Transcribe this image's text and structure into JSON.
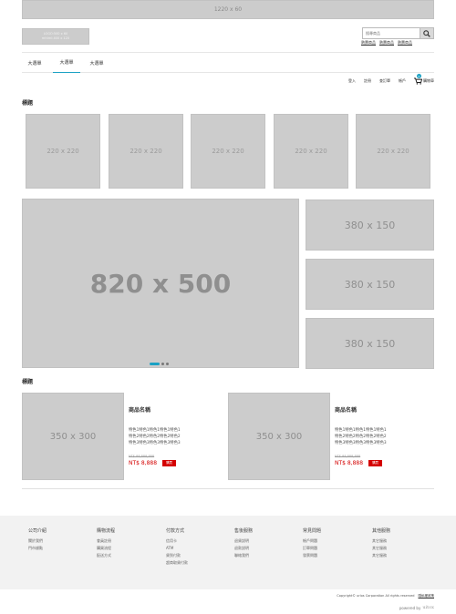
{
  "top_banner": {
    "label": "1220 x 60"
  },
  "header": {
    "logo": {
      "line1": "LOGO:500 x 60",
      "line2": "mhtml:400 x 120"
    },
    "search": {
      "placeholder": "搜尋商品"
    },
    "hot_links": [
      "熱賣商品",
      "熱賣商品",
      "熱賣商品"
    ]
  },
  "nav": {
    "items": [
      "大選單",
      "大選單",
      "大選單"
    ],
    "active_index": 1
  },
  "user_bar": {
    "login": "登入",
    "register": "註冊",
    "orders": "查訂單",
    "account": "帳戶",
    "cart": "購物車",
    "cart_count": "0"
  },
  "section1": {
    "title": "標題",
    "tiles": [
      "220 x 220",
      "220 x 220",
      "220 x 220",
      "220 x 220",
      "220 x 220"
    ]
  },
  "hero": {
    "main": "820 x 500",
    "side": [
      "380 x 150",
      "380 x 150",
      "380 x 150"
    ],
    "slide_count": 3,
    "active_slide": 0
  },
  "section2": {
    "title": "標題",
    "products": [
      {
        "image": "350 x 300",
        "name": "商品名稱",
        "desc": [
          "特色1特色1特色1特色1特色1",
          "特色2特色2特色2特色2特色2",
          "特色3特色3特色3特色3特色3"
        ],
        "orig_price": "NT$ 88,888,888",
        "price": "NT$ 8,888",
        "button": "購買"
      },
      {
        "image": "350 x 300",
        "name": "商品名稱",
        "desc": [
          "特色1特色1特色1特色1特色1",
          "特色2特色2特色2特色2特色2",
          "特色3特色3特色3特色3特色3"
        ],
        "orig_price": "NT$ 88,888,888",
        "price": "NT$ 8,888",
        "button": "購買"
      }
    ]
  },
  "footer": {
    "columns": [
      {
        "title": "公司介紹",
        "links": [
          "關於我們",
          "門市據點"
        ]
      },
      {
        "title": "購物流程",
        "links": [
          "會員註冊",
          "購買流程",
          "配送方式"
        ]
      },
      {
        "title": "付款方式",
        "links": [
          "信用卡",
          "ATM",
          "貨到付款",
          "超商取貨付款"
        ]
      },
      {
        "title": "售後服務",
        "links": [
          "退貨說明",
          "退款說明",
          "聯絡我們"
        ]
      },
      {
        "title": "常見問題",
        "links": [
          "帳戶問題",
          "訂單問題",
          "savings:發票問題"
        ]
      },
      {
        "title": "其他服務",
        "links": [
          "其它服務",
          "其它服務",
          "其它服務"
        ]
      }
    ],
    "copyright": "Copyright© urlos Corporation All rights reserved",
    "privacy": "隱私權政策",
    "powered_by": "powered by",
    "brand": "uitox"
  },
  "colors": {
    "accent": "#1ba1c4",
    "price": "#d40000",
    "placeholder": "#cccccc",
    "footer_bg": "#f2f2f2"
  }
}
